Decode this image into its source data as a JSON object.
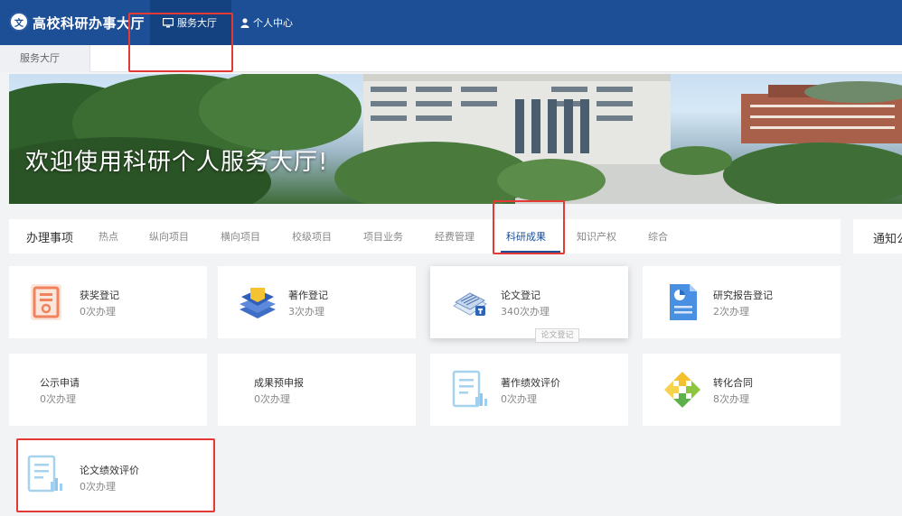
{
  "header": {
    "logo_text": "文",
    "app_title": "高校科研办事大厅",
    "nav": [
      {
        "label": "服务大厅",
        "icon": "monitor-icon"
      },
      {
        "label": "个人中心",
        "icon": "user-icon"
      }
    ]
  },
  "breadcrumb": {
    "label": "服务大厅"
  },
  "banner": {
    "welcome": "欢迎使用科研个人服务大厅!"
  },
  "tabs": {
    "main": "办理事项",
    "items": [
      "热点",
      "纵向项目",
      "横向项目",
      "校级项目",
      "项目业务",
      "经费管理",
      "科研成果",
      "知识产权",
      "综合"
    ],
    "active": "科研成果"
  },
  "notice": {
    "label": "通知公告"
  },
  "cards": [
    {
      "title": "获奖登记",
      "count": "0次办理",
      "icon": "award-certificate-icon"
    },
    {
      "title": "著作登记",
      "count": "3次办理",
      "icon": "books-icon"
    },
    {
      "title": "论文登记",
      "count": "340次办理",
      "icon": "paper-stack-icon"
    },
    {
      "title": "研究报告登记",
      "count": "2次办理",
      "icon": "report-document-icon"
    },
    {
      "title": "公示申请",
      "count": "0次办理",
      "icon": ""
    },
    {
      "title": "成果预申报",
      "count": "0次办理",
      "icon": ""
    },
    {
      "title": "著作绩效评价",
      "count": "0次办理",
      "icon": "document-chart-icon"
    },
    {
      "title": "转化合同",
      "count": "8次办理",
      "icon": "recycle-arrows-icon"
    },
    {
      "title": "论文绩效评价",
      "count": "0次办理",
      "icon": "document-chart-icon"
    }
  ],
  "tooltip": {
    "text": "论文登记"
  },
  "colors": {
    "primary": "#1d4f96",
    "highlight": "#e53935",
    "background": "#f2f3f5"
  }
}
